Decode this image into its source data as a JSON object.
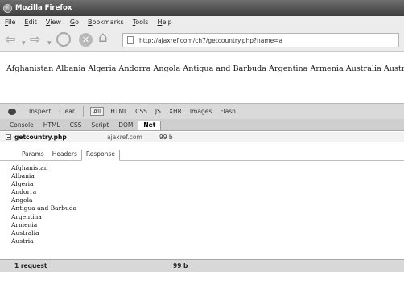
{
  "window": {
    "title": "Mozilla Firefox"
  },
  "menu": [
    "File",
    "Edit",
    "View",
    "Go",
    "Bookmarks",
    "Tools",
    "Help"
  ],
  "nav": {
    "url": "http://ajaxref.com/ch7/getcountry.php?name=a"
  },
  "page": {
    "countries_line": "Afghanistan Albania Algeria Andorra Angola Antigua and Barbuda Argentina Armenia Australia Austria"
  },
  "firebug": {
    "toolbar": [
      "Inspect",
      "Clear",
      "All",
      "HTML",
      "CSS",
      "JS",
      "XHR",
      "Images",
      "Flash"
    ],
    "tabs": [
      "Console",
      "HTML",
      "CSS",
      "Script",
      "DOM",
      "Net"
    ],
    "request": {
      "name": "getcountry.php",
      "host": "ajaxref.com",
      "size": "99 b"
    },
    "subtabs": [
      "Params",
      "Headers",
      "Response"
    ],
    "response_lines": [
      "Afghanistan",
      "Albania",
      "Algeria",
      "Andorra",
      "Angola",
      "Antigua and Barbuda",
      "Argentina",
      "Armenia",
      "Australia",
      "Austria"
    ],
    "summary": {
      "count": "1 request",
      "size": "99 b"
    }
  },
  "icons": [
    "firefox-logo-icon",
    "back-arrow-icon",
    "forward-arrow-icon",
    "reload-icon",
    "stop-icon",
    "home-icon",
    "page-icon",
    "firebug-icon",
    "expand-toggle-icon"
  ]
}
